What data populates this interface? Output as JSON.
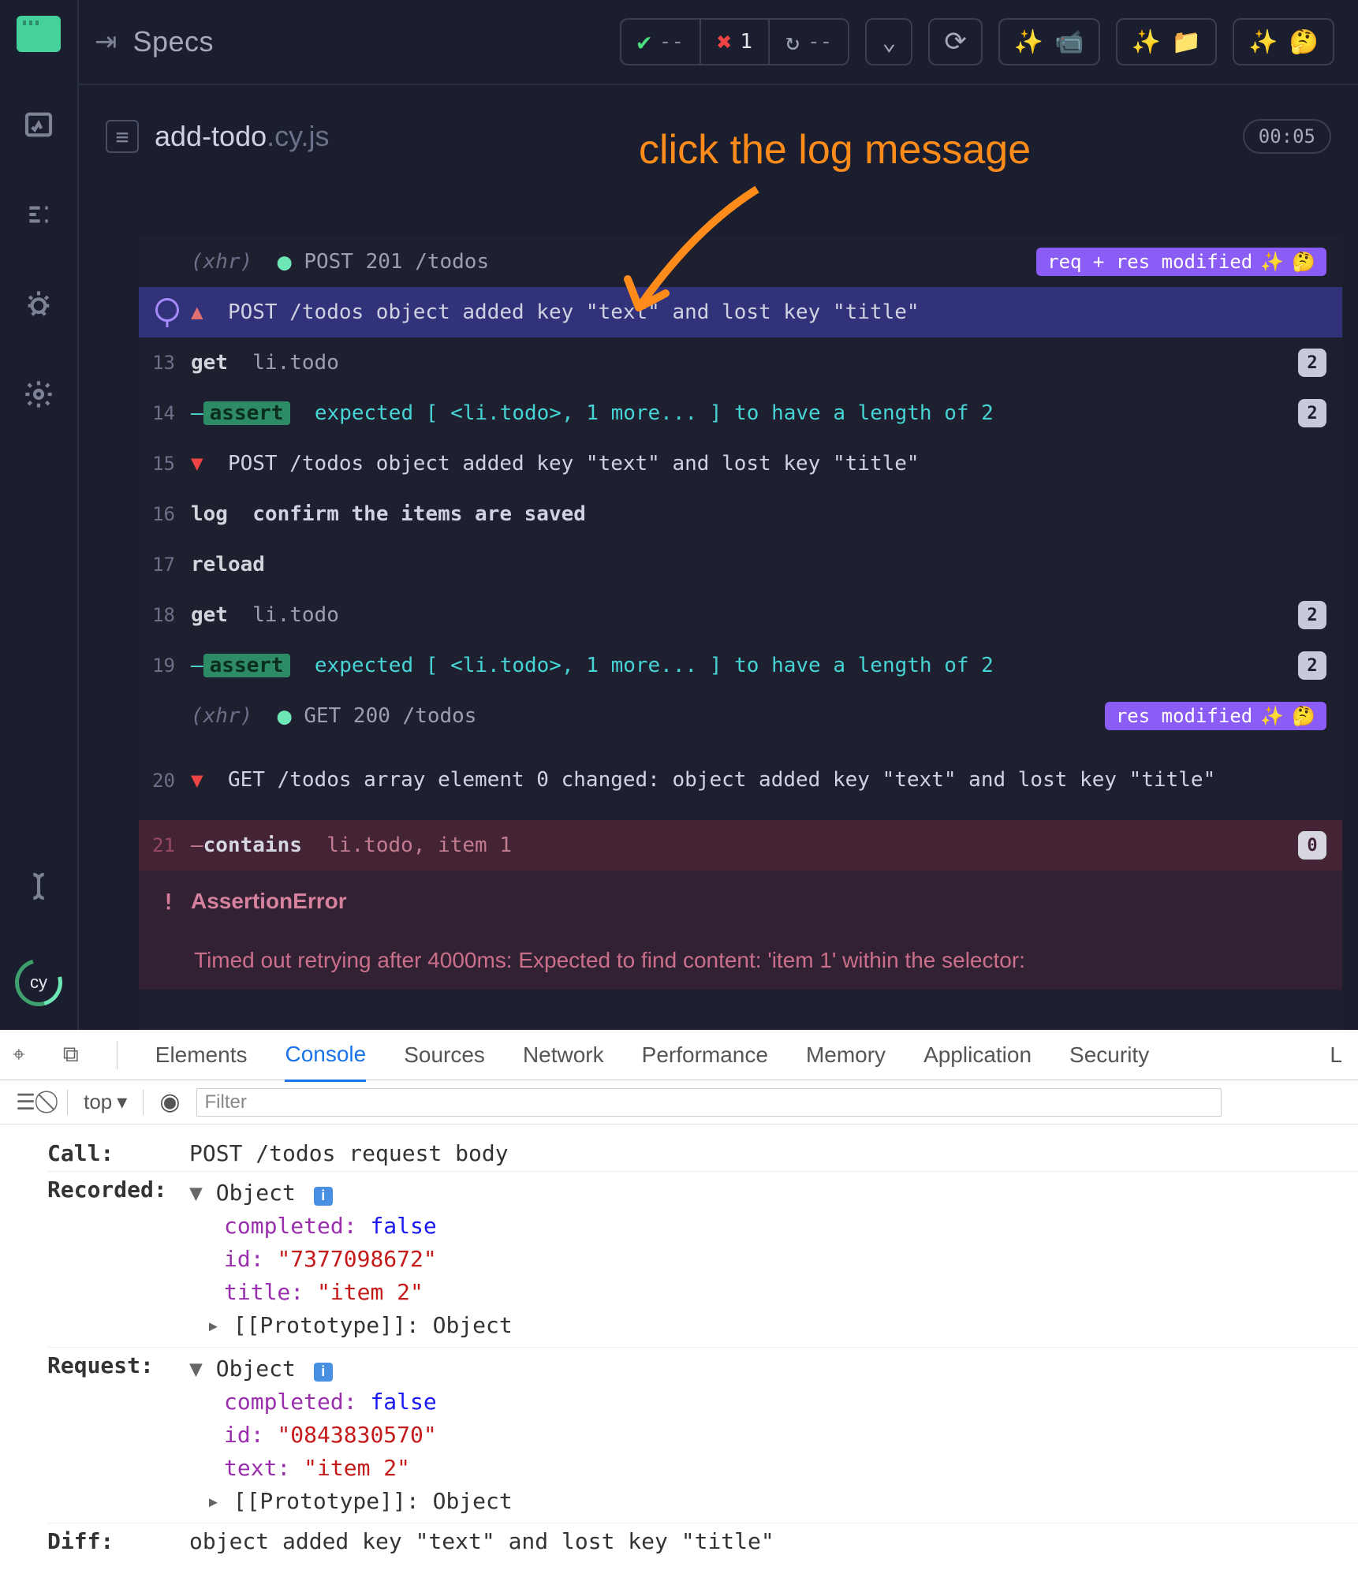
{
  "header": {
    "title": "Specs",
    "pass_dash": "--",
    "fail_count": "1",
    "rerun_dash": "--"
  },
  "spec": {
    "file_base": "add-todo",
    "file_ext": ".cy.js",
    "timer": "00:05"
  },
  "annotation": {
    "text": "click the log message"
  },
  "logs": {
    "xhr1_label": "(xhr)",
    "xhr1_cmd": "POST 201 /todos",
    "xhr1_badge": "req + res modified",
    "pinned_msg": "POST /todos object added key \"text\" and lost key \"title\"",
    "l13_num": "13",
    "l13_cmd": "get",
    "l13_arg": "li.todo",
    "l13_count": "2",
    "l14_num": "14",
    "l14_assert": "assert",
    "l14_expected": "expected  [ <li.todo>, 1 more... ]  to have a length of  2",
    "l14_count": "2",
    "l15_num": "15",
    "l15_msg": "POST /todos object added key \"text\" and lost key \"title\"",
    "l16_num": "16",
    "l16_cmd": "log",
    "l16_arg": "confirm the items are saved",
    "l17_num": "17",
    "l17_cmd": "reload",
    "l18_num": "18",
    "l18_cmd": "get",
    "l18_arg": "li.todo",
    "l18_count": "2",
    "l19_num": "19",
    "l19_assert": "assert",
    "l19_expected": "expected  [ <li.todo>, 1 more... ]  to have a length of  2",
    "l19_count": "2",
    "xhr2_label": "(xhr)",
    "xhr2_cmd": "GET 200 /todos",
    "xhr2_badge": "res modified",
    "l20_num": "20",
    "l20_msg": "GET /todos array element 0 changed: object added key \"text\" and lost key \"title\"",
    "l21_num": "21",
    "l21_cmd": "contains",
    "l21_arg": "li.todo, item 1",
    "l21_count": "0",
    "err_label": "AssertionError",
    "timeout_msg": "Timed out retrying after 4000ms: Expected to find content: 'item 1' within the selector: "
  },
  "devtools": {
    "tabs": {
      "elements": "Elements",
      "console": "Console",
      "sources": "Sources",
      "network": "Network",
      "performance": "Performance",
      "memory": "Memory",
      "application": "Application",
      "security": "Security",
      "overflow": "L"
    },
    "toolbar": {
      "context": "top",
      "filter_placeholder": "Filter"
    },
    "console": {
      "call_label": "Call:",
      "call_val": "POST /todos request body",
      "recorded_label": "Recorded:",
      "request_label": "Request:",
      "diff_label": "Diff:",
      "diff_val": "object added key \"text\" and lost key \"title\"",
      "obj_word": "Object",
      "proto": "[[Prototype]]:",
      "proto_val": "Object",
      "rec": {
        "completed_k": "completed:",
        "completed_v": "false",
        "id_k": "id:",
        "id_v": "\"7377098672\"",
        "title_k": "title:",
        "title_v": "\"item 2\""
      },
      "req": {
        "completed_k": "completed:",
        "completed_v": "false",
        "id_k": "id:",
        "id_v": "\"0843830570\"",
        "text_k": "text:",
        "text_v": "\"item 2\""
      }
    }
  }
}
